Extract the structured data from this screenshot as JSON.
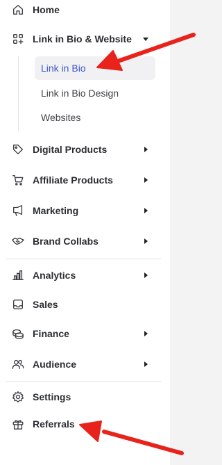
{
  "nav": {
    "home": "Home",
    "link_in_bio_website": "Link in Bio & Website",
    "sub": {
      "link_in_bio": "Link in Bio",
      "link_in_bio_design": "Link in Bio Design",
      "websites": "Websites"
    },
    "digital_products": "Digital Products",
    "affiliate_products": "Affiliate Products",
    "marketing": "Marketing",
    "brand_collabs": "Brand Collabs",
    "analytics": "Analytics",
    "sales": "Sales",
    "finance": "Finance",
    "audience": "Audience",
    "settings": "Settings",
    "referrals": "Referrals"
  },
  "icons": {
    "home": "home-icon",
    "link_in_bio_website": "grid-plus-icon",
    "digital_products": "tag-icon",
    "affiliate_products": "cart-icon",
    "marketing": "megaphone-icon",
    "brand_collabs": "handshake-icon",
    "analytics": "bar-chart-icon",
    "sales": "inbox-icon",
    "finance": "coins-icon",
    "audience": "users-icon",
    "settings": "gear-icon",
    "referrals": "gift-icon"
  },
  "colors": {
    "active_text": "#3d57c9",
    "annotation_arrow": "#e8231c"
  }
}
